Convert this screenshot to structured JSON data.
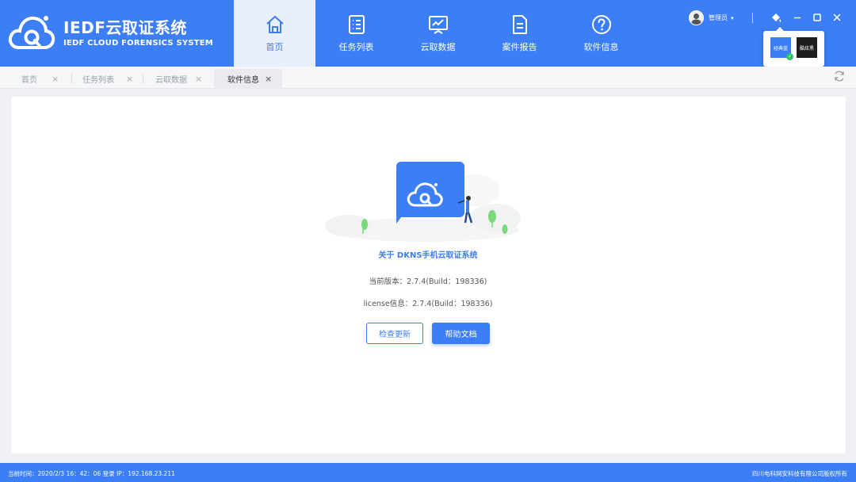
{
  "brand": {
    "title": "IEDF云取证系统",
    "subtitle": "IEDF CLOUD FORENSICS SYSTEM"
  },
  "nav": {
    "items": [
      {
        "label": "首页",
        "icon": "home-icon"
      },
      {
        "label": "任务列表",
        "icon": "task-list-icon"
      },
      {
        "label": "云取数据",
        "icon": "chart-board-icon"
      },
      {
        "label": "案件报告",
        "icon": "document-icon"
      },
      {
        "label": "软件信息",
        "icon": "question-circle-icon"
      }
    ],
    "active": "首页"
  },
  "user": {
    "name": "管理员",
    "caret": "▾"
  },
  "theme": {
    "options": [
      {
        "label": "经典蓝",
        "color": "#3b7ef6",
        "selected": true
      },
      {
        "label": "酷炫黑",
        "color": "#1e1e1e",
        "selected": false
      }
    ]
  },
  "tabs": [
    {
      "label": "首页",
      "close": "×"
    },
    {
      "label": "任务列表",
      "close": "×"
    },
    {
      "label": "云取数据",
      "close": "×"
    },
    {
      "label": "软件信息",
      "close": "×",
      "active": true
    }
  ],
  "about": {
    "title": "关于 DKNS手机云取证系统",
    "version": "当前版本：2.7.4(Build：198336)",
    "license": "license信息：2.7.4(Build：198336)",
    "check_update": "检查更新",
    "help_docs": "帮助文档"
  },
  "footer": {
    "status": "当前时间：2020/2/3 16：42：06  登录 IP：192.168.23.211",
    "copyright": "四川电科网安科技有限公司版权所有"
  },
  "colors": {
    "accent": "#3b7ef6",
    "footer_bg": "#3b7ef6"
  }
}
